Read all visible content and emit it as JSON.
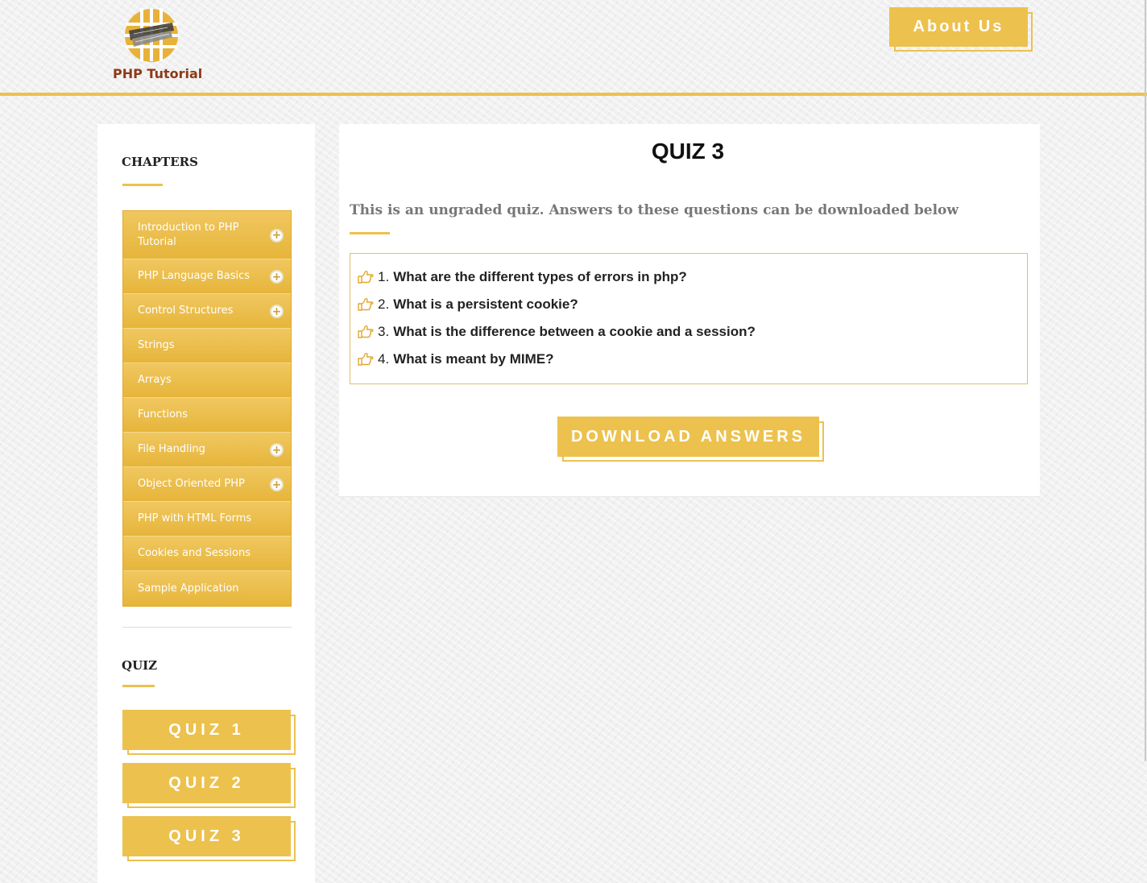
{
  "header": {
    "logo_text": "PHP Tutorial",
    "about_label": "About Us"
  },
  "colors": {
    "accent": "#ecc14d",
    "logo_text": "#8e3a17"
  },
  "sidebar": {
    "chapters_heading": "CHAPTERS",
    "chapters": [
      {
        "label": "Introduction to PHP Tutorial",
        "expandable": true
      },
      {
        "label": "PHP Language Basics",
        "expandable": true
      },
      {
        "label": "Control Structures",
        "expandable": true
      },
      {
        "label": "Strings",
        "expandable": false
      },
      {
        "label": "Arrays",
        "expandable": false
      },
      {
        "label": "Functions",
        "expandable": false
      },
      {
        "label": "File Handling",
        "expandable": true
      },
      {
        "label": "Object Oriented PHP",
        "expandable": true
      },
      {
        "label": "PHP with HTML Forms",
        "expandable": false
      },
      {
        "label": "Cookies and Sessions",
        "expandable": false
      },
      {
        "label": "Sample Application",
        "expandable": false
      }
    ],
    "quiz_heading": "QUIZ",
    "quiz_buttons": [
      "QUIZ 1",
      "QUIZ 2",
      "QUIZ 3"
    ]
  },
  "main": {
    "title": "QUIZ 3",
    "intro": "This is an ungraded quiz. Answers to these questions can be downloaded below",
    "questions": [
      {
        "num": "1.",
        "text": "What are the different types of errors in php?"
      },
      {
        "num": "2.",
        "text": "What is a persistent cookie?"
      },
      {
        "num": "3.",
        "text": "What is the difference between a cookie and a session?"
      },
      {
        "num": "4.",
        "text": "What is meant by MIME?"
      }
    ],
    "download_label": "DOWNLOAD ANSWERS",
    "question_icon": "hand-pointing-right-icon"
  }
}
